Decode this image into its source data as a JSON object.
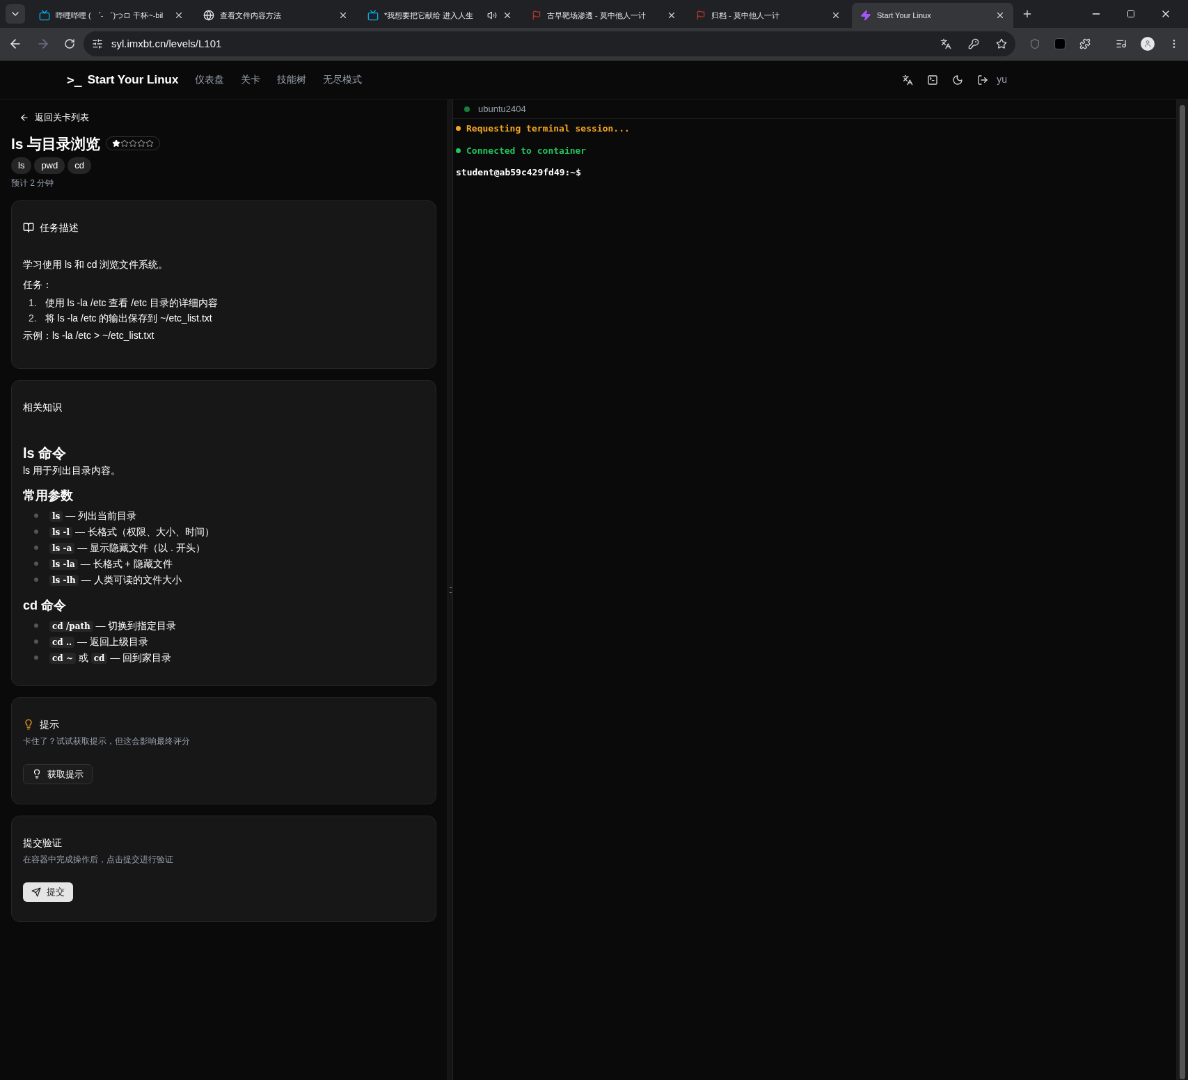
{
  "browser": {
    "tabs": [
      {
        "kind": "tv",
        "title": "哔哩哔哩 ( ゜- ゜)つロ 干杯~-bil",
        "selected": false,
        "audio": false
      },
      {
        "kind": "globe",
        "title": "查看文件内容方法",
        "selected": false,
        "audio": false
      },
      {
        "kind": "tv",
        "title": "*我想要把它献给 进入人生",
        "selected": false,
        "audio": true
      },
      {
        "kind": "flag",
        "title": "古早靶场渗透 - 莫中他人一计",
        "selected": false,
        "audio": false
      },
      {
        "kind": "flag",
        "title": "归档 - 莫中他人一计",
        "selected": false,
        "audio": false
      },
      {
        "kind": "bolt",
        "title": "Start Your Linux",
        "selected": true,
        "audio": false
      }
    ],
    "url": "syl.imxbt.cn/levels/L101"
  },
  "header": {
    "logo_mark": ">_",
    "brand": "Start Your Linux",
    "nav": [
      "仪表盘",
      "关卡",
      "技能树",
      "无尽模式"
    ],
    "user": "yu"
  },
  "level": {
    "back": "返回关卡列表",
    "title": "ls 与目录浏览",
    "stars": 1,
    "tags": [
      "ls",
      "pwd",
      "cd"
    ],
    "estimate": "预计 2 分钟"
  },
  "task": {
    "heading": "任务描述",
    "intro": "学习使用 ls 和 cd 浏览文件系统。",
    "label": "任务：",
    "steps": [
      {
        "number": "1.",
        "text": "使用 ls -la /etc 查看 /etc 目录的详细内容"
      },
      {
        "number": "2.",
        "text": "将 ls -la /etc 的输出保存到 ~/etc_list.txt"
      }
    ],
    "example": "示例：ls -la /etc > ~/etc_list.txt"
  },
  "knowledge": {
    "heading": "相关知识",
    "sections": [
      {
        "title": "ls 命令",
        "text": "ls 用于列出目录内容。"
      },
      {
        "title": "常用参数",
        "items": [
          [
            {
              "kind": "code",
              "text": "ls"
            },
            {
              "kind": "text",
              "text": " — 列出当前目录"
            }
          ],
          [
            {
              "kind": "code",
              "text": "ls -l"
            },
            {
              "kind": "text",
              "text": " — 长格式（权限、大小、时间）"
            }
          ],
          [
            {
              "kind": "code",
              "text": "ls -a"
            },
            {
              "kind": "text",
              "text": " — 显示隐藏文件（以 . 开头）"
            }
          ],
          [
            {
              "kind": "code",
              "text": "ls -la"
            },
            {
              "kind": "text",
              "text": " — 长格式 + 隐藏文件"
            }
          ],
          [
            {
              "kind": "code",
              "text": "ls -lh"
            },
            {
              "kind": "text",
              "text": " — 人类可读的文件大小"
            }
          ]
        ]
      },
      {
        "title": "cd 命令",
        "items": [
          [
            {
              "kind": "code",
              "text": "cd /path"
            },
            {
              "kind": "text",
              "text": " — 切换到指定目录"
            }
          ],
          [
            {
              "kind": "code",
              "text": "cd .."
            },
            {
              "kind": "text",
              "text": " — 返回上级目录"
            }
          ],
          [
            {
              "kind": "code",
              "text": "cd ~"
            },
            {
              "kind": "text",
              "text": " 或 "
            },
            {
              "kind": "code",
              "text": "cd"
            },
            {
              "kind": "text",
              "text": " — 回到家目录"
            }
          ]
        ]
      }
    ]
  },
  "hint": {
    "heading": "提示",
    "text": "卡住了？试试获取提示，但这会影响最终评分",
    "button": "获取提示"
  },
  "submit": {
    "heading": "提交验证",
    "text": "在容器中完成操作后，点击提交进行验证",
    "button": "提交"
  },
  "terminal": {
    "container": "ubuntu2404",
    "lines": [
      {
        "text": "Requesting terminal session...",
        "color": "#f5a524"
      },
      {
        "text": "Connected to container",
        "color": "#22c55e"
      }
    ],
    "prompt": "student@ab59c429fd49:~$"
  }
}
